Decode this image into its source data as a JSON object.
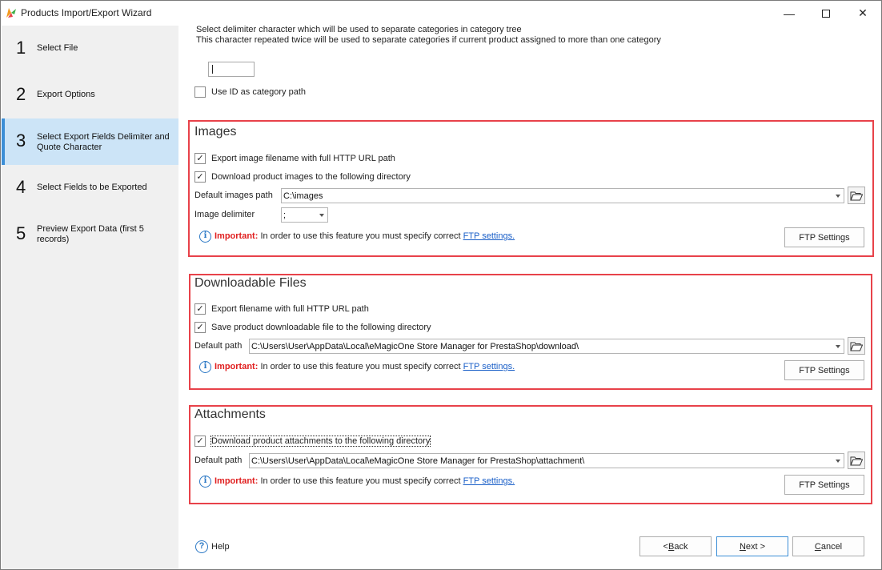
{
  "window": {
    "title": "Products Import/Export Wizard",
    "minimize_glyph": "—",
    "close_glyph": "✕",
    "icon": "app-logo-icon"
  },
  "sidebar": {
    "steps": [
      {
        "num": "1",
        "label": "Select File"
      },
      {
        "num": "2",
        "label": "Export Options"
      },
      {
        "num": "3",
        "label": "Select Export Fields Delimiter and Quote Character",
        "active": true
      },
      {
        "num": "4",
        "label": "Select Fields to be Exported"
      },
      {
        "num": "5",
        "label": "Preview Export Data (first 5 records)"
      }
    ]
  },
  "category": {
    "desc_line1": "Select delimiter character which will be used to separate categories in category tree",
    "desc_line2": "This character repeated twice will be used to separate categories if current product assigned to more than one category",
    "delimiter_value": "",
    "use_id_label": "Use ID as category path",
    "use_id_checked": false
  },
  "images": {
    "title": "Images",
    "export_full_url_label": "Export image filename with full HTTP URL path",
    "export_full_url_checked": true,
    "download_label": "Download product images to the following directory",
    "download_checked": true,
    "path_label": "Default images path",
    "path_value": "C:\\images",
    "delimiter_label": "Image delimiter",
    "delimiter_value": ";",
    "important": "Important:",
    "note": " In order to use this feature you must specify correct ",
    "link": "FTP settings.",
    "ftp_button": "FTP Settings"
  },
  "downloadable": {
    "title": "Downloadable Files",
    "export_full_url_label": "Export filename with full HTTP URL path",
    "export_full_url_checked": true,
    "save_label": "Save product downloadable file to the following directory",
    "save_checked": true,
    "path_label": "Default path",
    "path_value": "C:\\Users\\User\\AppData\\Local\\eMagicOne Store Manager for PrestaShop\\download\\",
    "important": "Important:",
    "note": " In order to use this feature you must specify correct ",
    "link": "FTP settings.",
    "ftp_button": "FTP Settings"
  },
  "attachments": {
    "title": "Attachments",
    "download_label": "Download product attachments to the following directory",
    "download_checked": true,
    "path_label": "Default path",
    "path_value": "C:\\Users\\User\\AppData\\Local\\eMagicOne Store Manager for PrestaShop\\attachment\\",
    "important": "Important:",
    "note": " In order to use this feature you must specify correct ",
    "link": "FTP settings.",
    "ftp_button": "FTP Settings"
  },
  "footer": {
    "help": "Help",
    "back_prefix": "< ",
    "back_u": "B",
    "back_rest": "ack",
    "next_u": "N",
    "next_rest": "ext >",
    "cancel_u": "C",
    "cancel_rest": "ancel"
  },
  "colors": {
    "highlight_border": "#e8424a",
    "active_step_bg": "#cce4f7",
    "important": "#e01e1e",
    "link": "#1a5fc8"
  }
}
